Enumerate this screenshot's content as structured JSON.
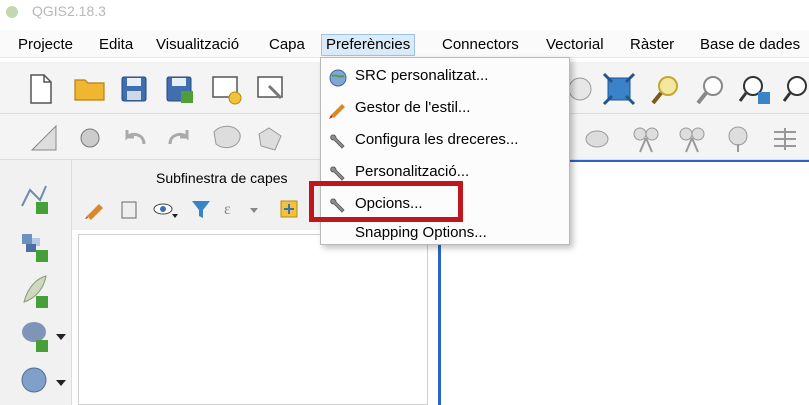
{
  "window": {
    "title": "QGIS2.18.3"
  },
  "menubar": {
    "items": [
      "Projecte",
      "Edita",
      "Visualització",
      "Capa",
      "Preferències",
      "Connectors",
      "Vectorial",
      "Ràster",
      "Base de dades"
    ],
    "active": "Preferències"
  },
  "preferences_menu": {
    "items": [
      {
        "label": "SRC personalitzat...",
        "icon": "globe-icon"
      },
      {
        "label": "Gestor de l'estil...",
        "icon": "brush-icon"
      },
      {
        "label": "Configura les dreceres...",
        "icon": "wrench-icon"
      },
      {
        "label": "Personalització...",
        "icon": "wrench-icon"
      },
      {
        "label": "Opcions...",
        "icon": "wrench-icon"
      },
      {
        "label": "Snapping Options...",
        "icon": ""
      }
    ],
    "highlighted": "Opcions...",
    "highlight_color": "#c0161c"
  },
  "layers_panel": {
    "title": "Subfinestra de capes"
  },
  "colors": {
    "canvas_border": "#2a64c8",
    "menu_active_bg": "#dbeaf8"
  }
}
